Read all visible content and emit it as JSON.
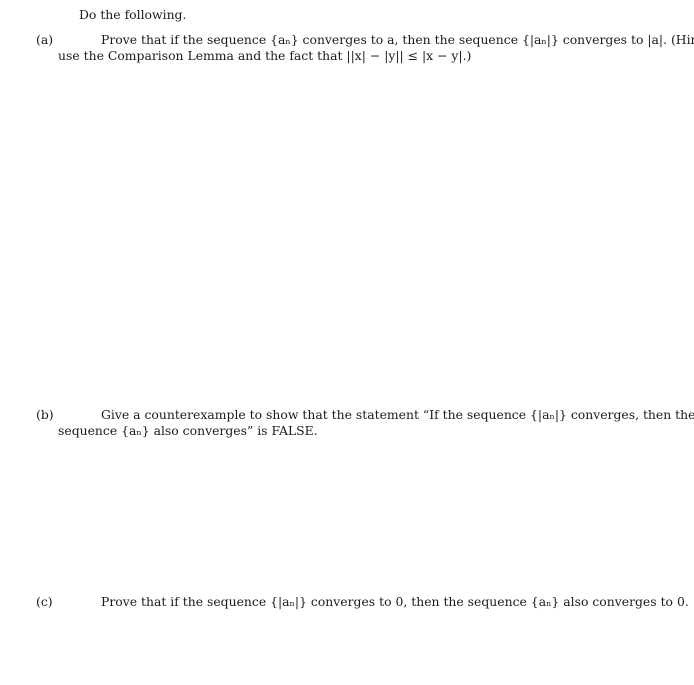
{
  "intro": "Do the following.",
  "parts": [
    {
      "label": "(a)",
      "line1": "Prove that if the sequence {aₙ} converges to a, then the sequence {|aₙ|} converges to |a|. (Hint:",
      "line2": "use the Comparison Lemma and the fact that ||x| − |y|| ≤ |x − y|.)"
    },
    {
      "label": "(b)",
      "line1": "Give a counterexample to show that the statement “If the sequence {|aₙ|} converges, then the",
      "line2": "sequence {aₙ} also converges” is FALSE."
    },
    {
      "label": "(c)",
      "line1": "Prove that if the sequence {|aₙ|} converges to 0, then the sequence {aₙ} also converges to 0.",
      "line2": ""
    }
  ]
}
